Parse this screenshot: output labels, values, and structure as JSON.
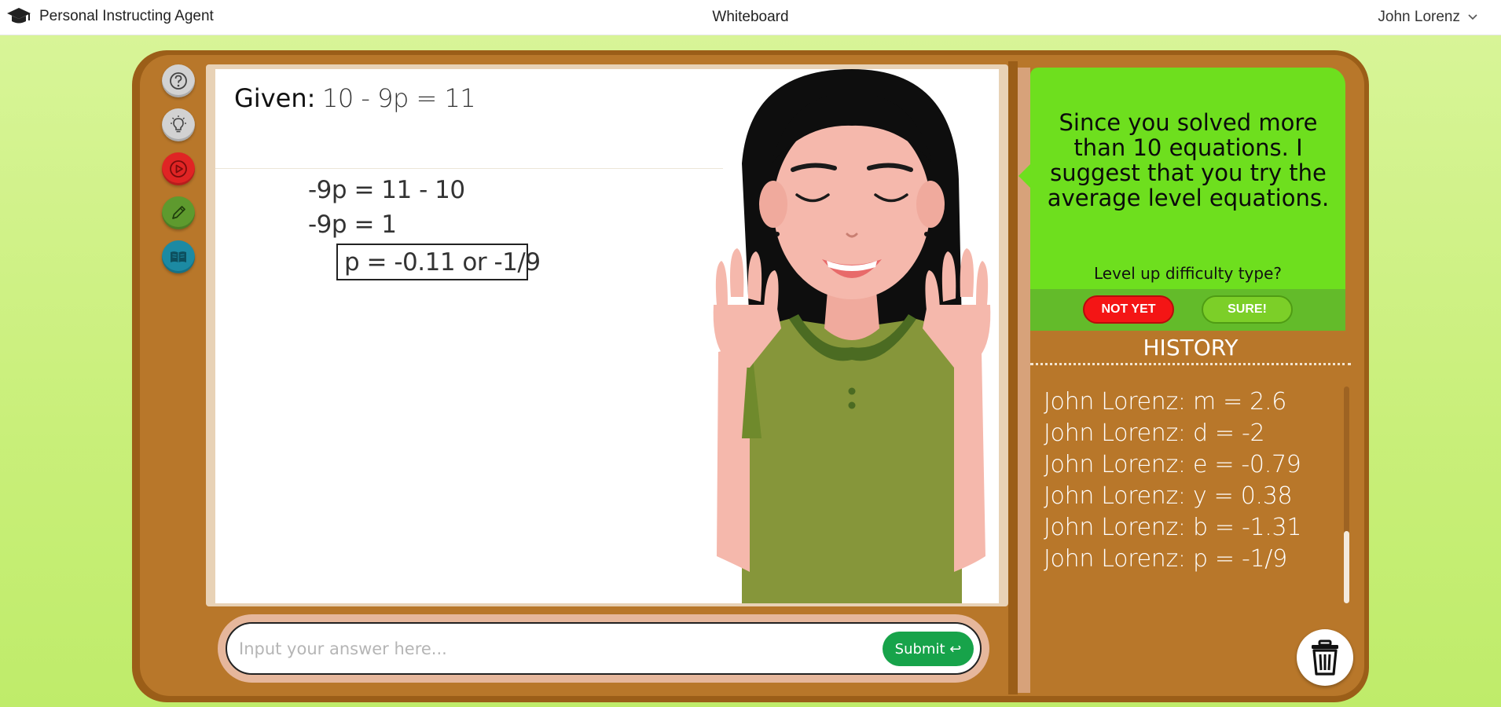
{
  "app": {
    "title": "Personal Instructing Agent",
    "logo_icon": "graduation-cap-icon"
  },
  "header": {
    "page_title": "Whiteboard",
    "user_name": "John Lorenz"
  },
  "tools": [
    {
      "name": "help-icon",
      "color": "#cfcfcf"
    },
    {
      "name": "lightbulb-icon",
      "color": "#cfcfcf"
    },
    {
      "name": "play-video-icon",
      "color": "#e02424"
    },
    {
      "name": "pencil-icon",
      "color": "#5e9a2e"
    },
    {
      "name": "book-icon",
      "color": "#1c8aa3"
    }
  ],
  "whiteboard": {
    "given_label": "Given:",
    "given_equation": "10 - 9p = 11",
    "steps": [
      "-9p = 11 - 10",
      "-9p = 1"
    ],
    "final_answer": "p = -0.11 or -1/9"
  },
  "agent_bubble": {
    "message": "Since you solved more than 10 equations. I suggest that you try the average level equations.",
    "question": "Level up difficulty type?",
    "decline_label": "NOT YET",
    "accept_label": "SURE!"
  },
  "history": {
    "title": "HISTORY",
    "items": [
      "John Lorenz: m = 2.6",
      "John Lorenz: d = -2",
      "John Lorenz: e = -0.79",
      "John Lorenz: y = 0.38",
      "John Lorenz: b = -1.31",
      "John Lorenz: p = -1/9"
    ]
  },
  "answer": {
    "placeholder": "Input your answer here...",
    "value": "",
    "submit_label": "Submit ↩"
  },
  "colors": {
    "background": "#c9ef7a",
    "board_frame": "#9b5e18",
    "board": "#b8772a",
    "bubble": "#6edf1e",
    "decline_button": "#f41515",
    "accept_button": "#7ccf28",
    "submit_button": "#17a34a"
  }
}
